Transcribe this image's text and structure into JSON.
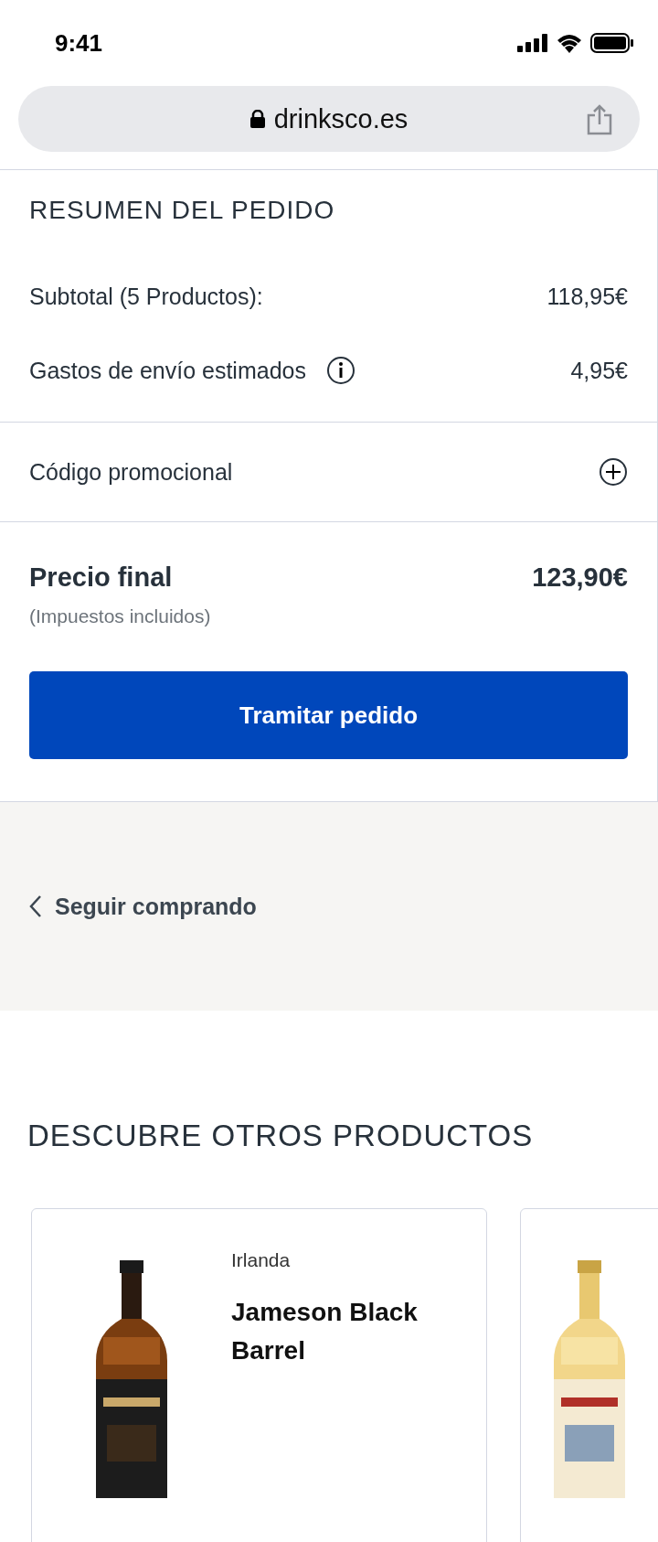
{
  "status_bar": {
    "time": "9:41"
  },
  "address_bar": {
    "url": "drinksco.es"
  },
  "order_summary": {
    "title": "RESUMEN DEL PEDIDO",
    "lines": [
      {
        "label": "Subtotal (5 Productos):",
        "value": "118,95€",
        "info": false
      },
      {
        "label": "Gastos de envío estimados",
        "value": "4,95€",
        "info": true
      }
    ],
    "promo": {
      "label": "Código promocional",
      "expanded": false
    },
    "total": {
      "label": "Precio final",
      "value": "123,90€",
      "note": "(Impuestos incluidos)"
    },
    "checkout_button": "Tramitar pedido"
  },
  "continue_link": "Seguir comprando",
  "recommendations": {
    "title": "DESCUBRE OTROS PRODUCTOS",
    "products": [
      {
        "kind": "detailed",
        "origin": "Irlanda",
        "name": "Jameson Black Barrel"
      },
      {
        "kind": "image_only"
      }
    ]
  }
}
